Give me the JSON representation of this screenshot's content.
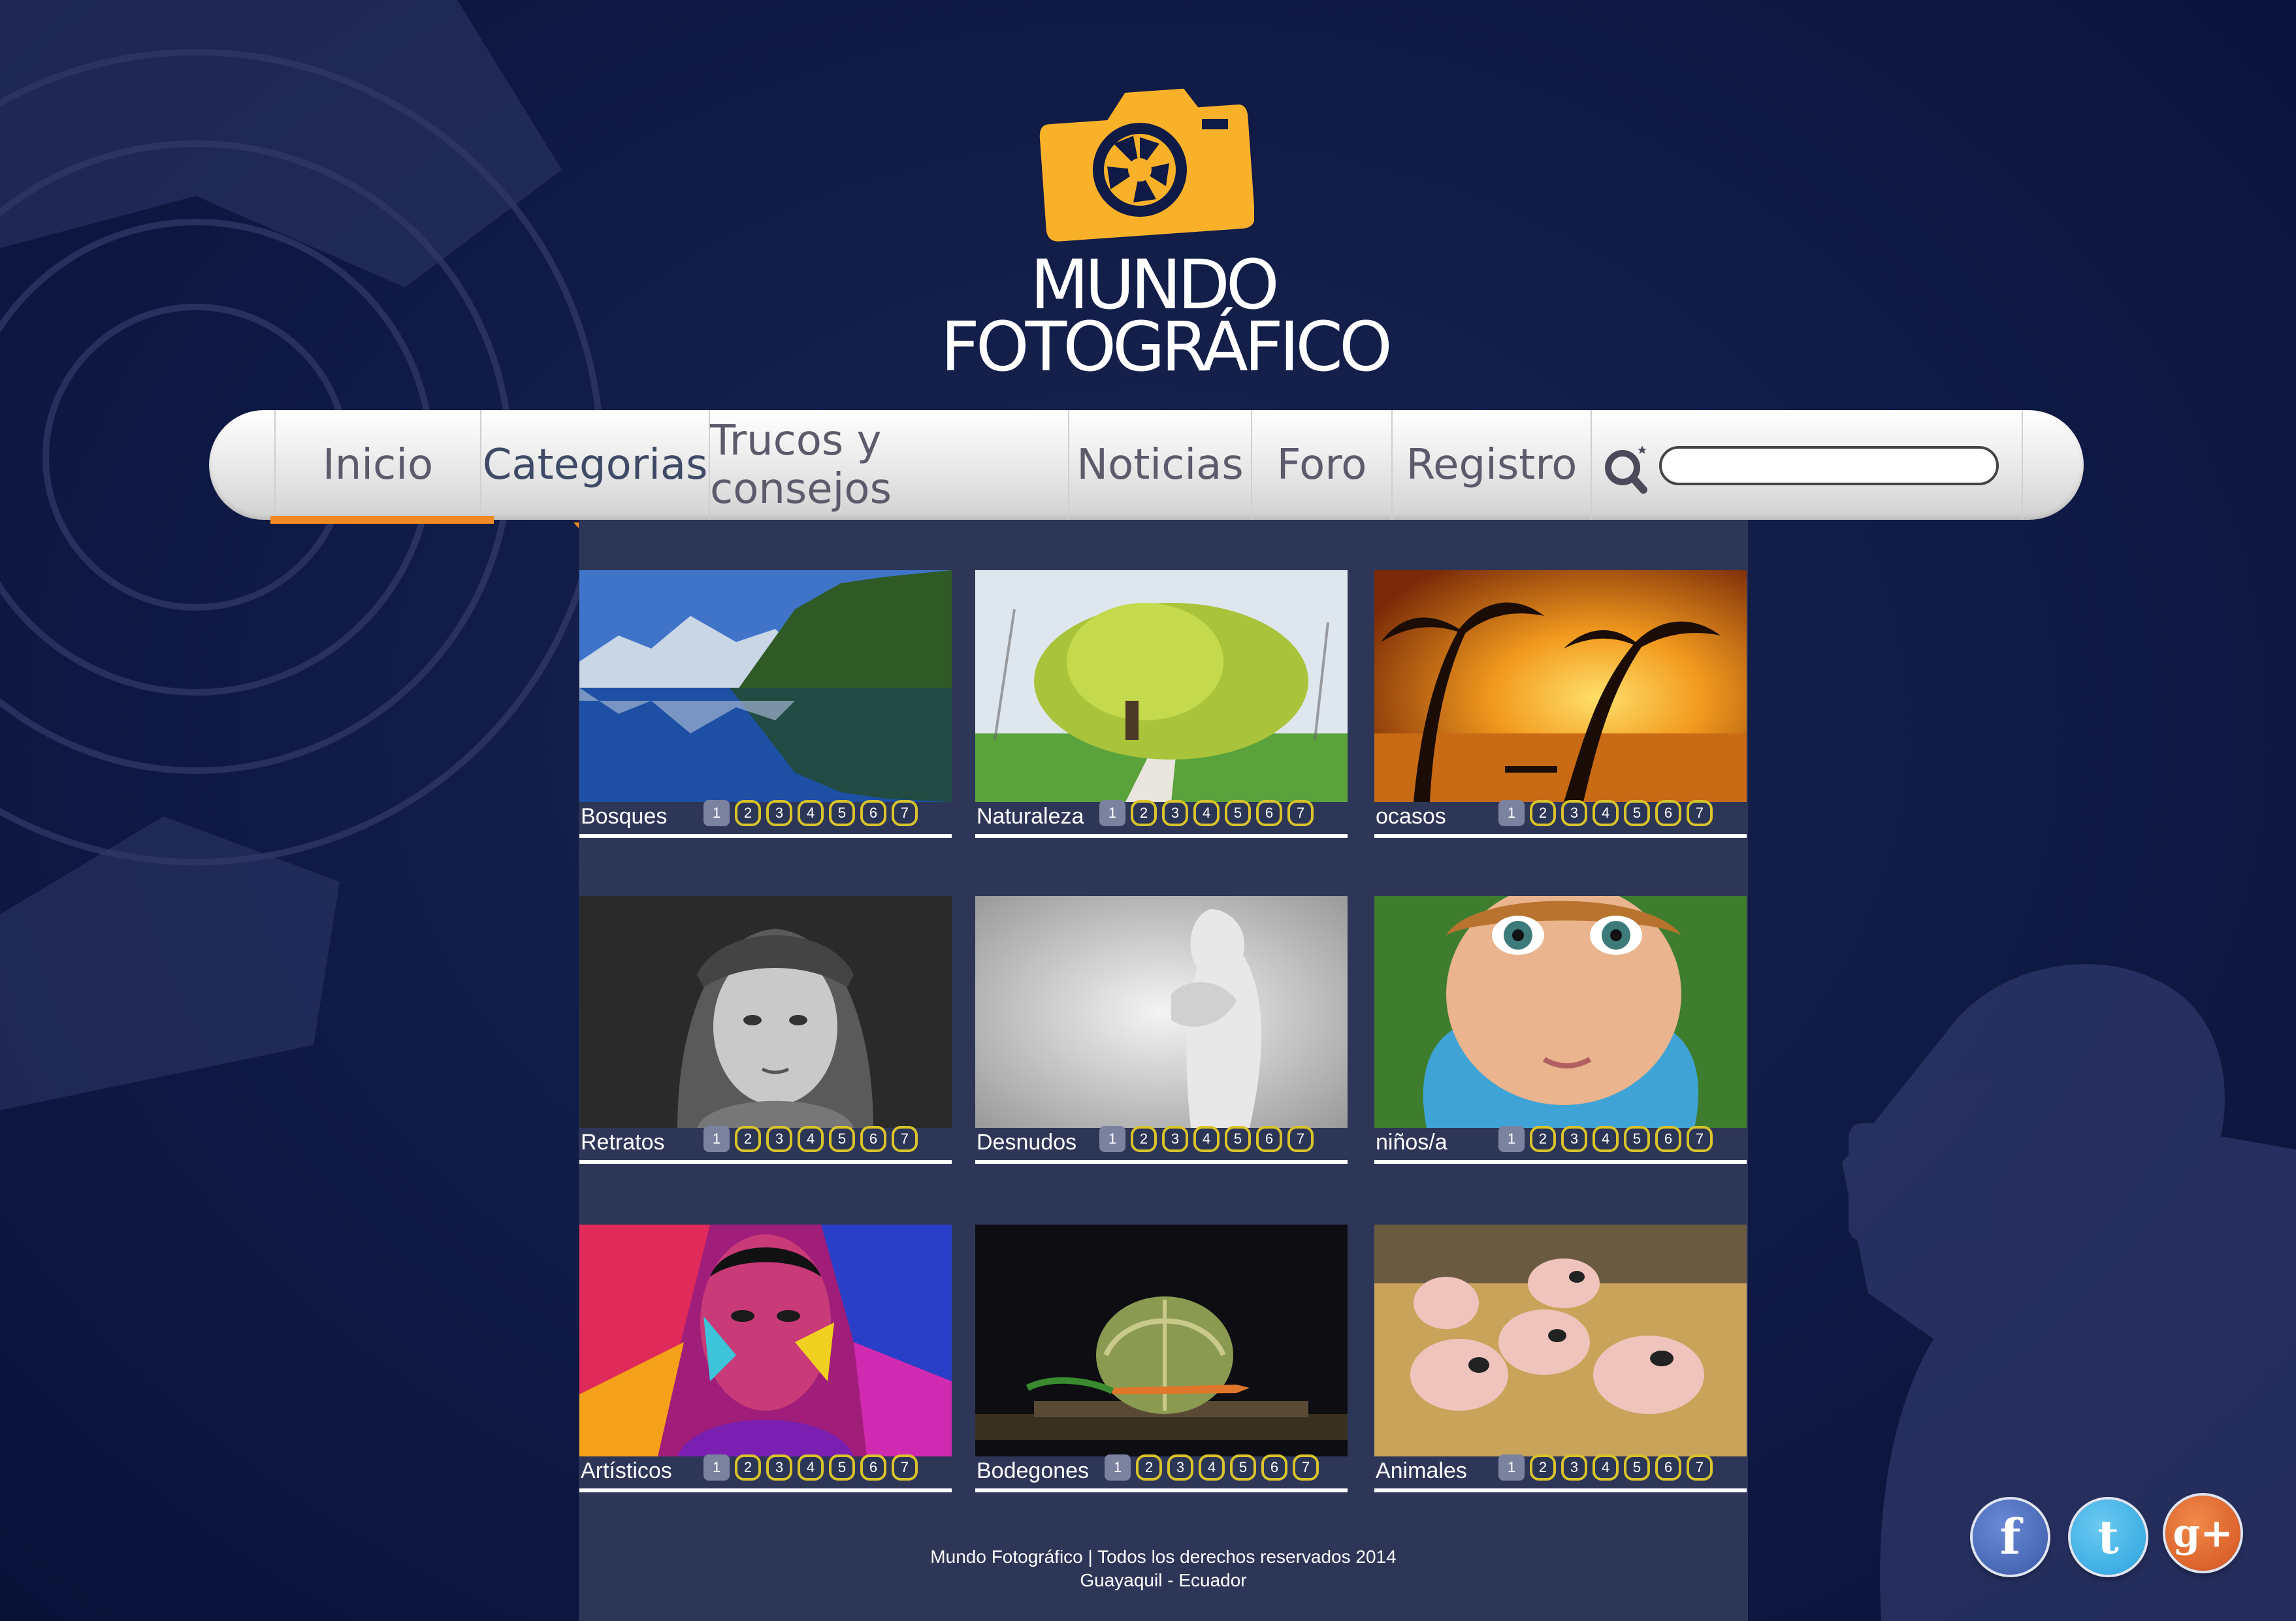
{
  "brand": {
    "line1": "MUNDO",
    "line2": "FOTOGRÁFICO",
    "icon": "camera-icon",
    "accent": "#f9b12a"
  },
  "nav": {
    "items": [
      {
        "label": "Inicio",
        "active": false
      },
      {
        "label": "Categorias",
        "active": true
      },
      {
        "label": "Trucos y consejos",
        "active": false
      },
      {
        "label": "Noticias",
        "active": false
      },
      {
        "label": "Foro",
        "active": false
      },
      {
        "label": "Registro",
        "active": false
      }
    ],
    "search": {
      "icon": "search-icon",
      "value": ""
    },
    "active_color": "#f08a24"
  },
  "gallery": {
    "pages": [
      "1",
      "2",
      "3",
      "4",
      "5",
      "6",
      "7"
    ],
    "categories": [
      {
        "label": "Bosques",
        "image": "lake-forest-photo"
      },
      {
        "label": "Naturaleza",
        "image": "willow-tree-photo"
      },
      {
        "label": "ocasos",
        "image": "sunset-palms-photo"
      },
      {
        "label": "Retratos",
        "image": "portrait-girl-photo"
      },
      {
        "label": "Desnudos",
        "image": "nude-figure-photo"
      },
      {
        "label": "niños/a",
        "image": "child-face-photo"
      },
      {
        "label": "Artísticos",
        "image": "painted-face-photo"
      },
      {
        "label": "Bodegones",
        "image": "cabbage-still-life-photo"
      },
      {
        "label": "Animales",
        "image": "piglets-photo"
      }
    ]
  },
  "footer": {
    "line1": "Mundo Fotográfico | Todos los derechos reservados 2014",
    "line2": "Guayaquil - Ecuador"
  },
  "social": [
    {
      "label": "f",
      "icon": "facebook-icon",
      "color": "#3b5aa8"
    },
    {
      "label": "t",
      "icon": "twitter-icon",
      "color": "#2aa3e0"
    },
    {
      "label": "g+",
      "icon": "google-plus-icon",
      "color": "#e0622c"
    }
  ]
}
